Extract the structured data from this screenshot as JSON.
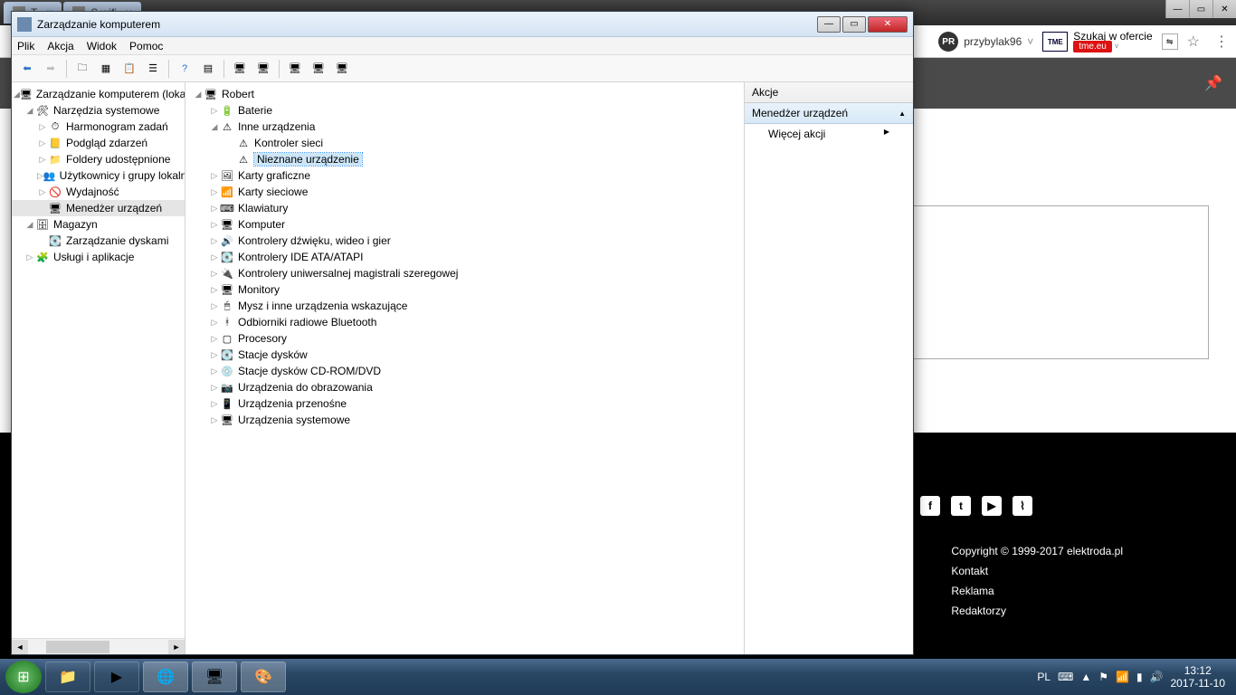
{
  "browser": {
    "tabs": [
      {
        "title": "T"
      },
      {
        "title": "S  wifi"
      }
    ],
    "user": "przybylak96",
    "tme_label": "Szukaj w ofercie",
    "tme_badge": "tme.eu"
  },
  "page": {
    "copyright": "Copyright © 1999-2017 elektroda.pl",
    "links": [
      "Kontakt",
      "Reklama",
      "Redaktorzy"
    ]
  },
  "mmc": {
    "title": "Zarządzanie komputerem",
    "menu": [
      "Plik",
      "Akcja",
      "Widok",
      "Pomoc"
    ],
    "left_tree": {
      "root": "Zarządzanie komputerem (lokalne)",
      "tools": "Narzędzia systemowe",
      "tools_children": [
        "Harmonogram zadań",
        "Podgląd zdarzeń",
        "Foldery udostępnione",
        "Użytkownicy i grupy lokalne",
        "Wydajność",
        "Menedżer urządzeń"
      ],
      "storage": "Magazyn",
      "storage_children": [
        "Zarządzanie dyskami"
      ],
      "services": "Usługi i aplikacje"
    },
    "devmgr": {
      "root": "Robert",
      "batteries": "Baterie",
      "other": "Inne urządzenia",
      "other_children": [
        "Kontroler sieci",
        "Nieznane urządzenie"
      ],
      "categories": [
        "Karty graficzne",
        "Karty sieciowe",
        "Klawiatury",
        "Komputer",
        "Kontrolery dźwięku, wideo i gier",
        "Kontrolery IDE ATA/ATAPI",
        "Kontrolery uniwersalnej magistrali szeregowej",
        "Monitory",
        "Mysz i inne urządzenia wskazujące",
        "Odbiorniki radiowe Bluetooth",
        "Procesory",
        "Stacje dysków",
        "Stacje dysków CD-ROM/DVD",
        "Urządzenia do obrazowania",
        "Urządzenia przenośne",
        "Urządzenia systemowe"
      ]
    },
    "actions": {
      "header": "Akcje",
      "section": "Menedżer urządzeń",
      "more": "Więcej akcji"
    }
  },
  "taskbar": {
    "lang": "PL",
    "time": "13:12",
    "date": "2017-11-10"
  }
}
